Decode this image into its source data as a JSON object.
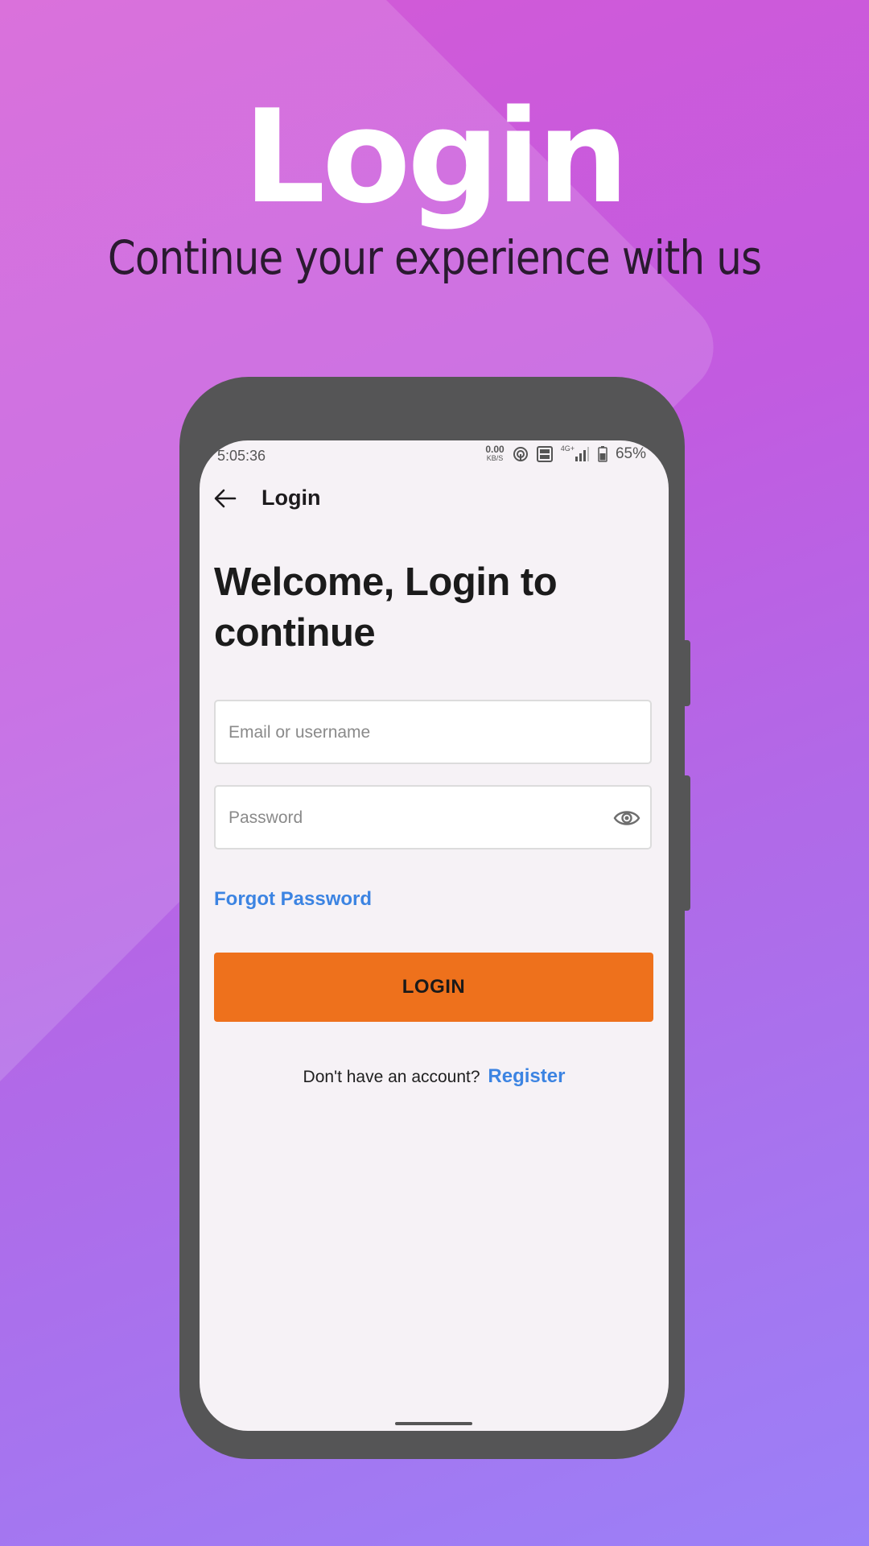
{
  "promo": {
    "title": "Login",
    "subtitle": "Continue your experience with us"
  },
  "status_bar": {
    "time": "5:05:36",
    "net_speed": "0.00",
    "net_unit": "KB/S",
    "network_type": "4G+",
    "battery": "65%",
    "icons": [
      "hotspot-icon",
      "volte-icon",
      "signal-icon",
      "battery-icon"
    ]
  },
  "app_bar": {
    "back_icon": "arrow-left-icon",
    "title": "Login"
  },
  "form": {
    "heading": "Welcome, Login to continue",
    "email_placeholder": "Email or username",
    "email_value": "",
    "password_placeholder": "Password",
    "password_value": "",
    "password_toggle_icon": "eye-icon",
    "forgot_label": "Forgot Password",
    "login_label": "LOGIN",
    "register_prompt": "Don't have an account?",
    "register_label": "Register"
  },
  "colors": {
    "primary_button": "#ee711c",
    "link": "#3c84e2",
    "screen_bg": "#f6f2f6",
    "phone_frame": "#555556"
  }
}
